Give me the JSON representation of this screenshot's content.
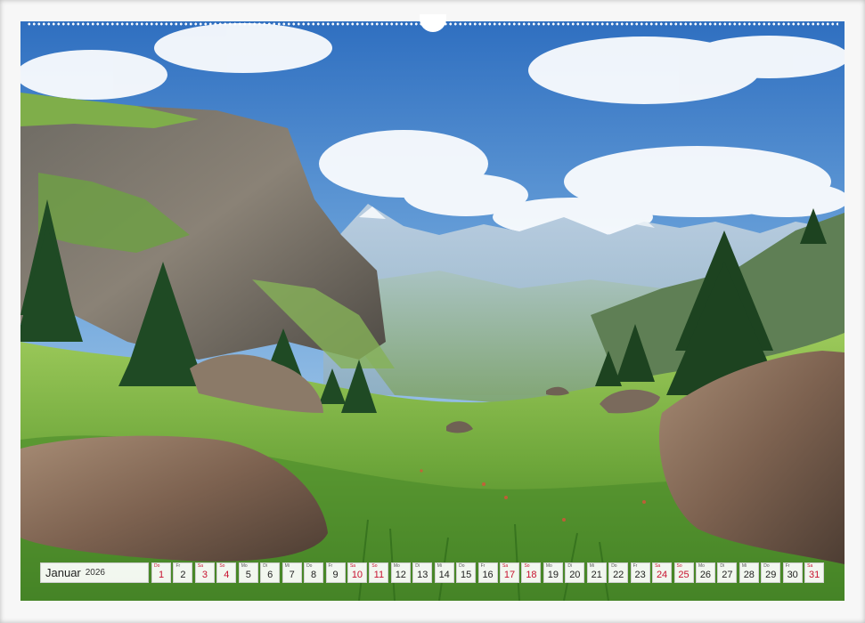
{
  "calendar": {
    "month": "Januar",
    "year": "2026",
    "accent_color": "#c8102e",
    "days": [
      {
        "wd": "Do",
        "num": "1",
        "red": true
      },
      {
        "wd": "Fr",
        "num": "2",
        "red": false
      },
      {
        "wd": "Sa",
        "num": "3",
        "red": true
      },
      {
        "wd": "So",
        "num": "4",
        "red": true
      },
      {
        "wd": "Mo",
        "num": "5",
        "red": false
      },
      {
        "wd": "Di",
        "num": "6",
        "red": false
      },
      {
        "wd": "Mi",
        "num": "7",
        "red": false
      },
      {
        "wd": "Do",
        "num": "8",
        "red": false
      },
      {
        "wd": "Fr",
        "num": "9",
        "red": false
      },
      {
        "wd": "Sa",
        "num": "10",
        "red": true
      },
      {
        "wd": "So",
        "num": "11",
        "red": true
      },
      {
        "wd": "Mo",
        "num": "12",
        "red": false
      },
      {
        "wd": "Di",
        "num": "13",
        "red": false
      },
      {
        "wd": "Mi",
        "num": "14",
        "red": false
      },
      {
        "wd": "Do",
        "num": "15",
        "red": false
      },
      {
        "wd": "Fr",
        "num": "16",
        "red": false
      },
      {
        "wd": "Sa",
        "num": "17",
        "red": true
      },
      {
        "wd": "So",
        "num": "18",
        "red": true
      },
      {
        "wd": "Mo",
        "num": "19",
        "red": false
      },
      {
        "wd": "Di",
        "num": "20",
        "red": false
      },
      {
        "wd": "Mi",
        "num": "21",
        "red": false
      },
      {
        "wd": "Do",
        "num": "22",
        "red": false
      },
      {
        "wd": "Fr",
        "num": "23",
        "red": false
      },
      {
        "wd": "Sa",
        "num": "24",
        "red": true
      },
      {
        "wd": "So",
        "num": "25",
        "red": true
      },
      {
        "wd": "Mo",
        "num": "26",
        "red": false
      },
      {
        "wd": "Di",
        "num": "27",
        "red": false
      },
      {
        "wd": "Mi",
        "num": "28",
        "red": false
      },
      {
        "wd": "Do",
        "num": "29",
        "red": false
      },
      {
        "wd": "Fr",
        "num": "30",
        "red": false
      },
      {
        "wd": "Sa",
        "num": "31",
        "red": true
      }
    ]
  }
}
